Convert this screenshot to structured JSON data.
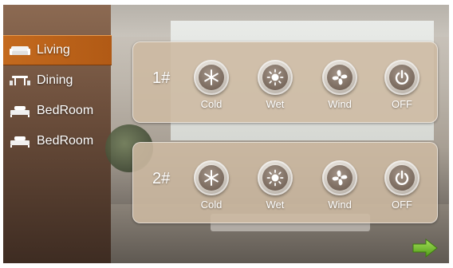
{
  "sidebar": {
    "items": [
      {
        "label": "Living",
        "icon": "sofa-icon",
        "active": true
      },
      {
        "label": "Dining",
        "icon": "dining-table-icon",
        "active": false
      },
      {
        "label": "BedRoom",
        "icon": "bed-icon",
        "active": false
      },
      {
        "label": "BedRoom",
        "icon": "bed-icon",
        "active": false
      }
    ]
  },
  "units": [
    {
      "label": "1#",
      "controls": [
        {
          "label": "Cold",
          "icon": "snowflake-icon"
        },
        {
          "label": "Wet",
          "icon": "sun-icon"
        },
        {
          "label": "Wind",
          "icon": "fan-icon"
        },
        {
          "label": "OFF",
          "icon": "power-icon"
        }
      ]
    },
    {
      "label": "2#",
      "controls": [
        {
          "label": "Cold",
          "icon": "snowflake-icon"
        },
        {
          "label": "Wet",
          "icon": "sun-icon"
        },
        {
          "label": "Wind",
          "icon": "fan-icon"
        },
        {
          "label": "OFF",
          "icon": "power-icon"
        }
      ]
    }
  ],
  "navigation": {
    "next_icon": "arrow-right-icon"
  },
  "colors": {
    "active_tab": "#c46a1e",
    "panel": "#cdb9a2",
    "next_arrow": "#7cc22c"
  }
}
